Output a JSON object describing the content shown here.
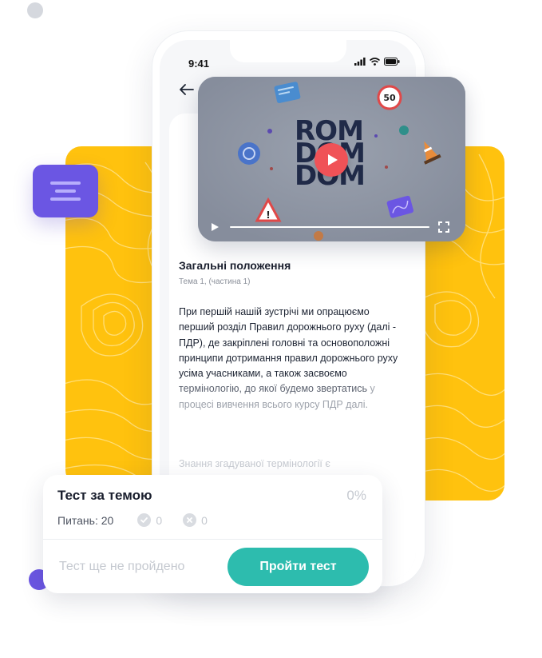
{
  "status_bar": {
    "time": "9:41"
  },
  "video": {
    "logo_lines": [
      "ROM",
      "DOM",
      "DOM"
    ],
    "sign_speed_limit": "50",
    "sign_warning": "!"
  },
  "lesson": {
    "title": "Загальні положення",
    "subtitle": "Тема 1, (частина 1)",
    "body_main": "При першій нашій зустрічі ми опрацюємо перший розділ Правил дорожнього руху (далі - ПДР), де закріплені головні та основоположні принципи дотримання правил дорожнього руху усіма учасниками, а також засвоємо",
    "body_fade1": " термінологію, до якої будемо звертатись",
    "body_fade2": " у процесі вивчення всього курсу ПДР далі.",
    "body_more": "Знання згадуваної термінології є"
  },
  "test_card": {
    "title": "Тест за темою",
    "percent": "0%",
    "questions_label": "Питань: 20",
    "correct_count": "0",
    "wrong_count": "0",
    "status_text": "Тест ще не пройдено",
    "button_label": "Пройти тест"
  },
  "colors": {
    "accent_teal": "#2dbcae",
    "accent_purple": "#6b56e3",
    "accent_yellow": "#ffc20e",
    "play_red": "#f05257",
    "text_dark": "#1a1f2e",
    "text_muted": "#c5c9d0"
  },
  "icons": {
    "back": "arrow-left-icon",
    "menu": "menu-lines-icon",
    "play": "play-icon",
    "fullscreen": "fullscreen-icon",
    "check": "check-circle-icon",
    "cross": "close-circle-icon"
  }
}
